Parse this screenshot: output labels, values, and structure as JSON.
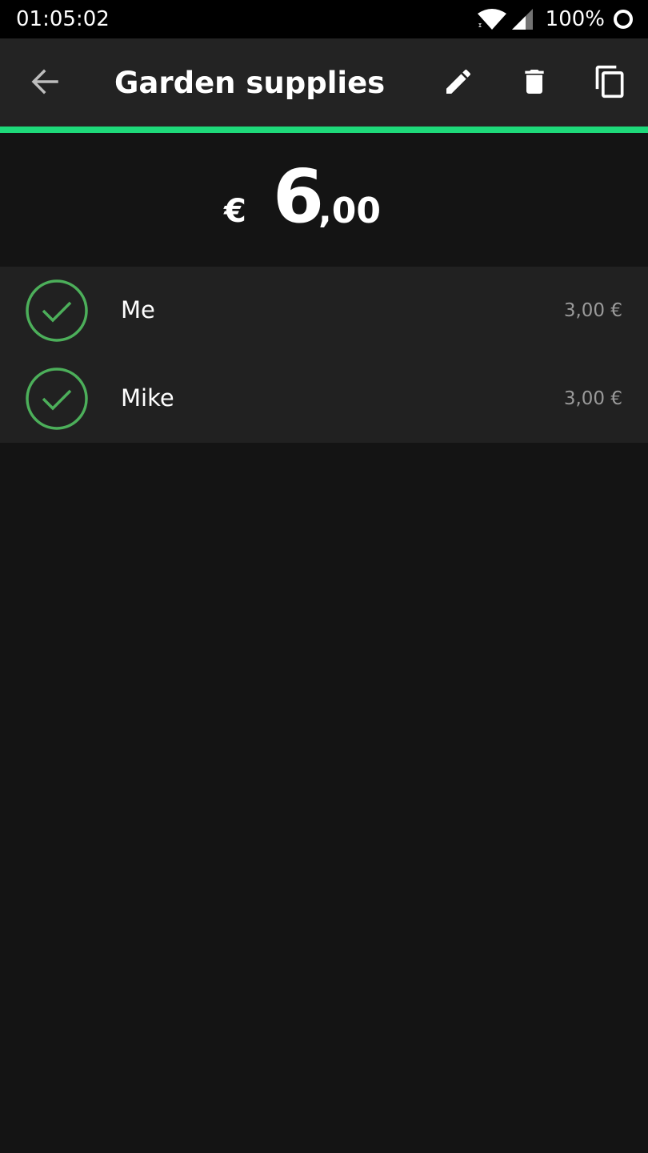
{
  "status_bar": {
    "time": "01:05:02",
    "battery": "100%"
  },
  "toolbar": {
    "title": "Garden supplies",
    "icons": [
      "arrow-back-icon",
      "pencil-icon",
      "trash-icon",
      "copy-icon"
    ]
  },
  "amount": {
    "currency": "€",
    "integer_part": "6",
    "decimal_part": ",00"
  },
  "shares": [
    {
      "name": "Me",
      "amount": "3,00 €",
      "checked": true
    },
    {
      "name": "Mike",
      "amount": "3,00 €",
      "checked": true
    }
  ],
  "colors": {
    "accent": "#1ed97a",
    "check": "#4caf5a",
    "toolbar": "#232323",
    "background": "#141414",
    "list_background": "#212121"
  }
}
